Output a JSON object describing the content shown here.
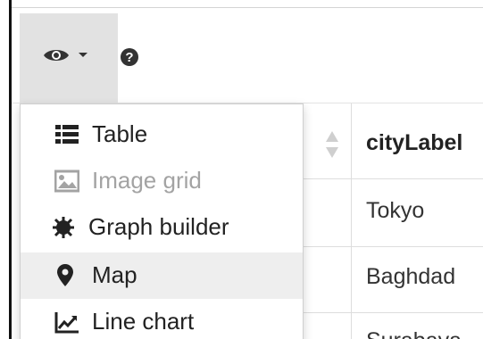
{
  "toolbar": {
    "view_icon": "eye-icon",
    "caret_icon": "caret-down-icon",
    "help_icon": "question-circle-icon"
  },
  "menu": {
    "items": [
      {
        "label": "Table",
        "icon": "table-icon",
        "state": "normal"
      },
      {
        "label": "Image grid",
        "icon": "image-icon",
        "state": "disabled"
      },
      {
        "label": "Graph builder",
        "icon": "graph-builder-icon",
        "state": "normal"
      },
      {
        "label": "Map",
        "icon": "map-marker-icon",
        "state": "active"
      },
      {
        "label": "Line chart",
        "icon": "line-chart-icon",
        "state": "normal"
      }
    ]
  },
  "table": {
    "header": "cityLabel",
    "rows": [
      "Tokyo",
      "Baghdad",
      "Surabaya"
    ]
  },
  "colors": {
    "toggle_bg": "#e2e2e2",
    "active_item_bg": "#eeeeee",
    "disabled_text": "#a3a3a3"
  }
}
